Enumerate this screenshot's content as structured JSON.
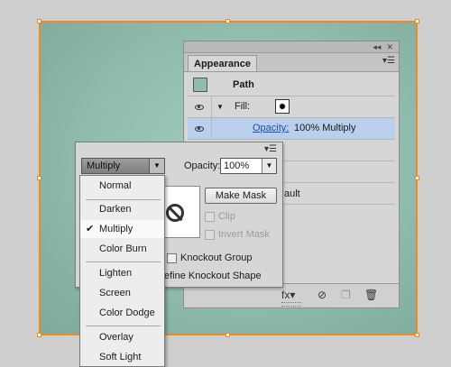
{
  "appearance": {
    "window_controls": [
      "◂◂",
      "✕"
    ],
    "tab": "Appearance",
    "menu_glyph": "▾☰",
    "object_label": "Path",
    "fill_label": "Fill:",
    "opacity_link": "Opacity:",
    "opacity_value": "100% Multiply",
    "partial_text": "ault",
    "colors": {
      "selection": "#f08a1c",
      "object_fill": "#8fbcaf",
      "highlight_row": "#b9cfec"
    }
  },
  "transparency": {
    "menu_glyph": "▾☰",
    "blend_mode": "Multiply",
    "opacity_label": "Opacity:",
    "opacity_value": "100%",
    "make_mask": "Make Mask",
    "clip": "Clip",
    "invert_mask": "Invert Mask",
    "knockout_group": "Knockout Group",
    "define_knockout": "efine Knockout Shape"
  },
  "blend_modes": {
    "items": [
      "Normal",
      "Darken",
      "Multiply",
      "Color Burn",
      "Lighten",
      "Screen",
      "Color Dodge",
      "Overlay",
      "Soft Light"
    ],
    "selected": "Multiply",
    "check": "✔"
  }
}
